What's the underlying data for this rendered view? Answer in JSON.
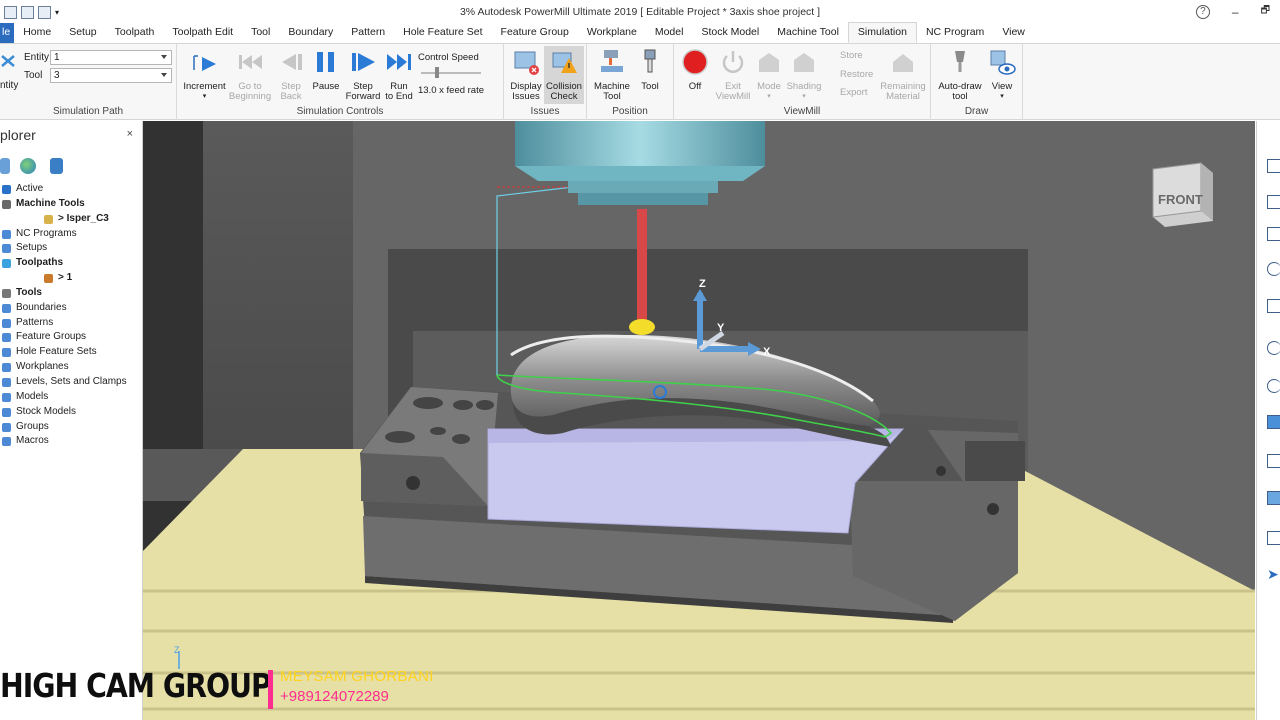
{
  "window": {
    "title": "3% Autodesk PowerMill Ultimate 2019   [ Editable Project * 3axis shoe project ]",
    "help_icon": "help-icon",
    "min_glyph": "–",
    "max_glyph": "🗗"
  },
  "tabs": [
    {
      "label": "le",
      "name": "tab-file"
    },
    {
      "label": "Home",
      "name": "tab-home"
    },
    {
      "label": "Setup",
      "name": "tab-setup"
    },
    {
      "label": "Toolpath",
      "name": "tab-toolpath"
    },
    {
      "label": "Toolpath Edit",
      "name": "tab-toolpath-edit"
    },
    {
      "label": "Tool",
      "name": "tab-tool"
    },
    {
      "label": "Boundary",
      "name": "tab-boundary"
    },
    {
      "label": "Pattern",
      "name": "tab-pattern"
    },
    {
      "label": "Hole Feature Set",
      "name": "tab-hole-feature-set"
    },
    {
      "label": "Feature Group",
      "name": "tab-feature-group"
    },
    {
      "label": "Workplane",
      "name": "tab-workplane"
    },
    {
      "label": "Model",
      "name": "tab-model"
    },
    {
      "label": "Stock Model",
      "name": "tab-stock-model"
    },
    {
      "label": "Machine Tool",
      "name": "tab-machine-tool"
    },
    {
      "label": "Simulation",
      "name": "tab-simulation",
      "active": true
    },
    {
      "label": "NC Program",
      "name": "tab-nc-program"
    },
    {
      "label": "View",
      "name": "tab-view"
    }
  ],
  "ribbon": {
    "sim_path": {
      "entity_label": "Entity",
      "entity_value": "1",
      "tool_label": "Tool",
      "tool_value": "3",
      "side_label": "ntity",
      "group_label": "Simulation Path"
    },
    "controls": {
      "increment": "Increment",
      "go_to_beginning_1": "Go to",
      "go_to_beginning_2": "Beginning",
      "step_back_1": "Step",
      "step_back_2": "Back",
      "pause": "Pause",
      "step_forward_1": "Step",
      "step_forward_2": "Forward",
      "run_to_end_1": "Run",
      "run_to_end_2": "to End",
      "speed_label": "Control Speed",
      "feed_rate": "13.0 x feed rate",
      "group_label": "Simulation Controls"
    },
    "issues": {
      "display_1": "Display",
      "display_2": "Issues",
      "collision_1": "Collision",
      "collision_2": "Check",
      "group_label": "Issues"
    },
    "position": {
      "machine_1": "Machine",
      "machine_2": "Tool",
      "tool": "Tool",
      "group_label": "Position"
    },
    "viewmill": {
      "off": "Off",
      "exit_1": "Exit",
      "exit_2": "ViewMill",
      "mode": "Mode",
      "shading": "Shading",
      "store": "Store",
      "restore": "Restore",
      "export": "Export",
      "remaining_1": "Remaining",
      "remaining_2": "Material",
      "group_label": "ViewMill"
    },
    "draw": {
      "auto_1": "Auto-draw",
      "auto_2": "tool",
      "view": "View",
      "group_label": "Draw"
    }
  },
  "explorer": {
    "title": "plorer",
    "close": "×",
    "items": [
      {
        "label": "Active",
        "bold": false,
        "indent": 16,
        "color": "#2a72c9"
      },
      {
        "label": "Machine Tools",
        "bold": true,
        "indent": 16,
        "color": "#6a6a6a"
      },
      {
        "label": "> Isper_C3",
        "bold": true,
        "indent": 58,
        "color": "#d7b24a"
      },
      {
        "label": "NC Programs",
        "bold": false,
        "indent": 16,
        "color": "#4c8ad6"
      },
      {
        "label": "Setups",
        "bold": false,
        "indent": 16,
        "color": "#4c8ad6"
      },
      {
        "label": "Toolpaths",
        "bold": true,
        "indent": 16,
        "color": "#3ba2e0"
      },
      {
        "label": "> 1",
        "bold": true,
        "indent": 58,
        "color": "#c97a2a"
      },
      {
        "label": "Tools",
        "bold": true,
        "indent": 16,
        "color": "#777777"
      },
      {
        "label": "Boundaries",
        "bold": false,
        "indent": 16,
        "color": "#4c8ad6"
      },
      {
        "label": "Patterns",
        "bold": false,
        "indent": 16,
        "color": "#4c8ad6"
      },
      {
        "label": "Feature Groups",
        "bold": false,
        "indent": 16,
        "color": "#4c8ad6"
      },
      {
        "label": "Hole Feature Sets",
        "bold": false,
        "indent": 16,
        "color": "#4c8ad6"
      },
      {
        "label": "Workplanes",
        "bold": false,
        "indent": 16,
        "color": "#4c8ad6"
      },
      {
        "label": "Levels, Sets and Clamps",
        "bold": false,
        "indent": 16,
        "color": "#4c8ad6"
      },
      {
        "label": "Models",
        "bold": false,
        "indent": 16,
        "color": "#4c8ad6"
      },
      {
        "label": "Stock Models",
        "bold": false,
        "indent": 16,
        "color": "#4c8ad6"
      },
      {
        "label": "Groups",
        "bold": false,
        "indent": 16,
        "color": "#4c8ad6"
      },
      {
        "label": "Macros",
        "bold": false,
        "indent": 16,
        "color": "#4c8ad6"
      }
    ]
  },
  "viewport": {
    "viewcube_label": "FRONT",
    "axis_z": "Z",
    "axis_y": "Y",
    "axis_x": "X",
    "small_axis_z": "Z"
  },
  "watermark": {
    "brand": "HIGH CAM GROUP",
    "name": "MEYSAM GHORBANI",
    "phone": "+989124072289"
  },
  "colors": {
    "accent": "#2b6cbf",
    "stock": "#c9c8ee",
    "table": "#e8e2a8",
    "spindle": "#7fbcc8",
    "tool_shank": "#d84848",
    "toolpath": "#3fd14a",
    "watermark_pink": "#ff2d8f",
    "watermark_yellow": "#ffd21d"
  }
}
